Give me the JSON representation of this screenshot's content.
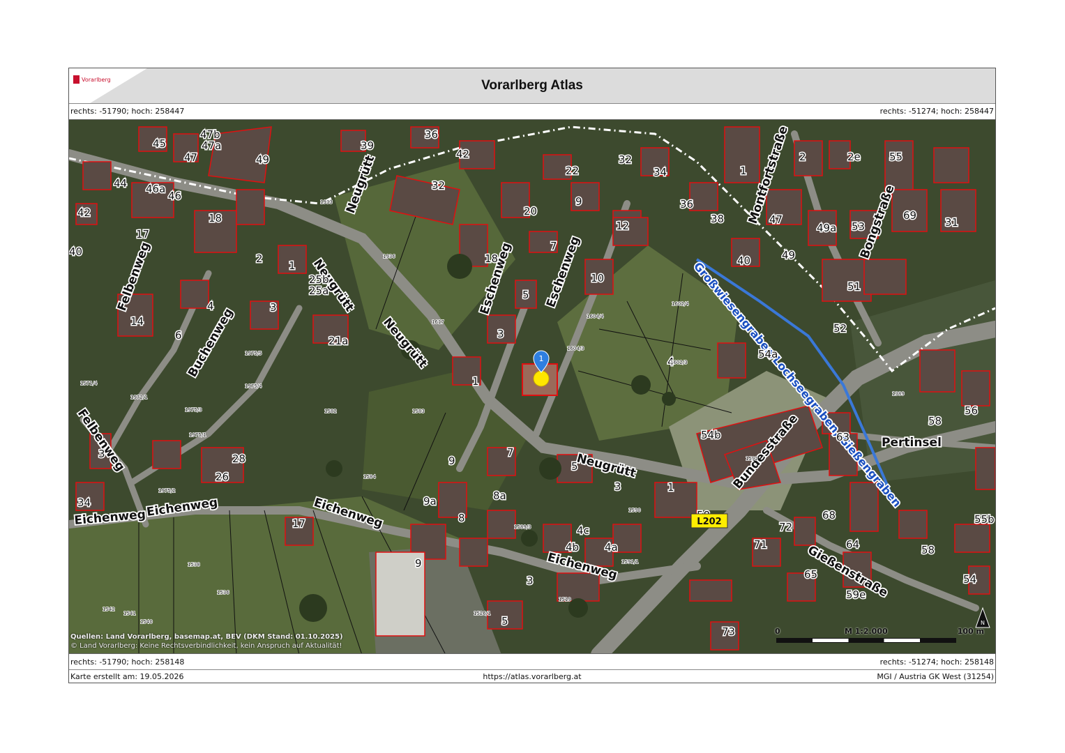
{
  "header": {
    "logo_text": "Vorarlberg",
    "title": "Vorarlberg Atlas"
  },
  "coords": {
    "top_left": "rechts: -51790; hoch: 258447",
    "top_right": "rechts: -51274; hoch: 258447",
    "bottom_left": "rechts: -51790; hoch: 258148",
    "bottom_right": "rechts: -51274; hoch: 258148"
  },
  "map": {
    "road_badge": "L202",
    "marker_label": "1",
    "streets": [
      "Neugrütt",
      "Neugrütt",
      "Neugrütt",
      "Neugrütt",
      "Eschenweg",
      "Eschenweg",
      "Felbenweg",
      "Felbenweg",
      "Buchenweg",
      "Eichenweg",
      "Eichenweg",
      "Eichenweg",
      "Eichenweg",
      "Bundesstraße",
      "Gießenstraße",
      "Montfortstraße",
      "Bongstraße",
      "Pertinsel"
    ],
    "waterway": "Großwiesengraben/Lochseegraben, Gießengraben",
    "house_numbers": [
      "45",
      "47b",
      "47a",
      "47",
      "49",
      "39",
      "36",
      "42",
      "32",
      "22",
      "32",
      "34",
      "1",
      "2",
      "2e",
      "55",
      "44",
      "46a",
      "46",
      "42",
      "18",
      "17",
      "2",
      "40",
      "1",
      "25b",
      "25a",
      "4",
      "3",
      "14",
      "6",
      "21a",
      "20",
      "9",
      "12",
      "36",
      "38",
      "47",
      "49a",
      "53",
      "69",
      "31",
      "18",
      "7",
      "5",
      "3",
      "1",
      "10",
      "40",
      "49",
      "51",
      "52",
      "54a",
      "4",
      "54b",
      "63",
      "58",
      "56",
      "3",
      "28",
      "26",
      "34",
      "9",
      "7",
      "5",
      "3",
      "1",
      "58",
      "8a",
      "9a",
      "8",
      "17",
      "4c",
      "4b",
      "4a",
      "72",
      "68",
      "64",
      "58",
      "55b",
      "71",
      "65",
      "59e",
      "54",
      "9",
      "3",
      "5",
      "73"
    ],
    "parcel_numbers": [
      "1933",
      "1936",
      "1617",
      "1582",
      "1583",
      "1584",
      "1592",
      "1389",
      "1975/5",
      "1975/4",
      "1975/3",
      "1975/1",
      "1975/2",
      "1972/1",
      "1571/4",
      "1602/4",
      "1602/3",
      "1604/4",
      "1604/3",
      "1538",
      "1536",
      "1542",
      "1541",
      "1540",
      "1526/1",
      "1590",
      "1589/3",
      "1591/1",
      "1519"
    ]
  },
  "sources": {
    "line1_bold": "Quellen: Land Vorarlberg, basemap.at, BEV (DKM Stand: 01.10.2025)",
    "line2": "© Land Vorarlberg: Keine Rechtsverbindlichkeit, kein Anspruch auf Aktualität!"
  },
  "scale": {
    "start": "0",
    "ratio": "M 1:2.000",
    "end": "100 m"
  },
  "footer": {
    "created": "Karte erstellt am: 19.05.2026",
    "url": "https://atlas.vorarlberg.at",
    "crs": "MGI / Austria GK West (31254)"
  }
}
